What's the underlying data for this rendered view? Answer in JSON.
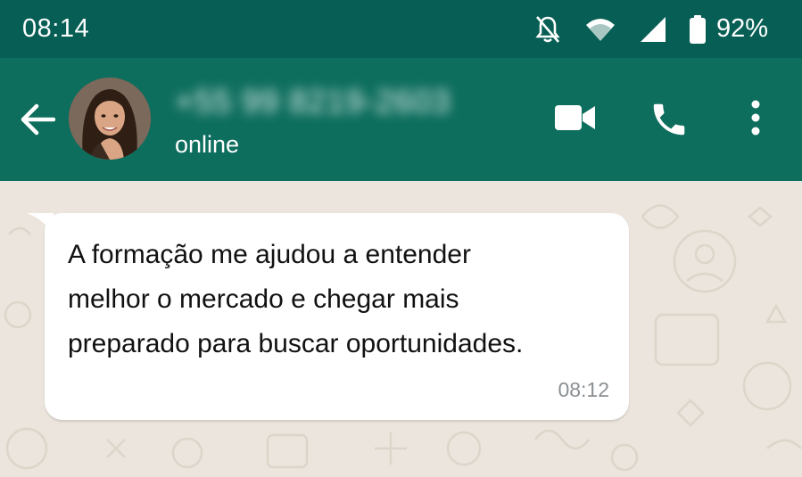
{
  "status_bar": {
    "time": "08:14",
    "battery_percent": "92%",
    "icons": [
      "notifications-off-icon",
      "wifi-icon",
      "signal-icon",
      "battery-icon"
    ]
  },
  "header": {
    "contact_name": "+55 99 8219-2603",
    "contact_status": "online",
    "icons": [
      "back-arrow-icon",
      "video-call-icon",
      "phone-call-icon",
      "more-vert-icon"
    ]
  },
  "message": {
    "text_lines": [
      "A formação me ajudou a entender",
      "melhor o mercado e chegar mais",
      "preparado para buscar oportunidades."
    ],
    "time": "08:12"
  },
  "colors": {
    "status_bar": "#075e54",
    "app_bar": "#0e6e5e",
    "chat_background": "#ece5dd",
    "bubble": "#ffffff"
  }
}
